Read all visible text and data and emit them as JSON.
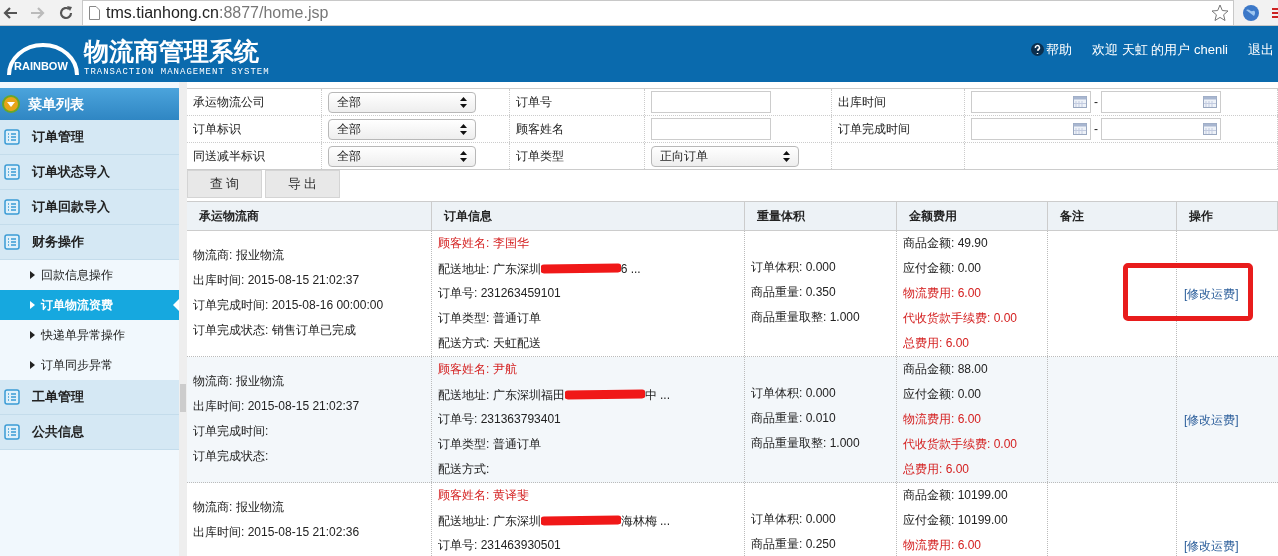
{
  "browser": {
    "url_host": "tms.tianhong.cn",
    "url_path": ":8877/home.jsp"
  },
  "header": {
    "logo_text": "RAINBOW",
    "title": "物流商管理系统",
    "subtitle": "TRANSACTION MANAGEMENT SYSTEM",
    "help": "帮助",
    "welcome": "欢迎 天虹 的用户 chenli",
    "logout": "退出"
  },
  "sidebar": {
    "title": "菜单列表",
    "items": [
      {
        "label": "订单管理",
        "kind": "group",
        "selected": false
      },
      {
        "label": "订单状态导入",
        "kind": "group",
        "selected": false
      },
      {
        "label": "订单回款导入",
        "kind": "group",
        "selected": false
      },
      {
        "label": "财务操作",
        "kind": "group",
        "selected": false
      },
      {
        "label": "回款信息操作",
        "kind": "sub",
        "selected": false
      },
      {
        "label": "订单物流资费",
        "kind": "sub",
        "selected": true
      },
      {
        "label": "快递单异常操作",
        "kind": "sub",
        "selected": false
      },
      {
        "label": "订单同步异常",
        "kind": "sub",
        "selected": false
      },
      {
        "label": "工单管理",
        "kind": "group",
        "selected": false
      },
      {
        "label": "公共信息",
        "kind": "group",
        "selected": false
      }
    ]
  },
  "filters": [
    [
      {
        "kind": "label",
        "text": "承运物流公司"
      },
      {
        "kind": "select",
        "value": "全部"
      },
      {
        "kind": "label",
        "text": "订单号"
      },
      {
        "kind": "input"
      },
      {
        "kind": "label",
        "text": "出库时间"
      },
      {
        "kind": "daterange",
        "separator": "-"
      }
    ],
    [
      {
        "kind": "label",
        "text": "订单标识"
      },
      {
        "kind": "select",
        "value": "全部"
      },
      {
        "kind": "label",
        "text": "顾客姓名"
      },
      {
        "kind": "input"
      },
      {
        "kind": "label",
        "text": "订单完成时间"
      },
      {
        "kind": "daterange",
        "separator": "-"
      }
    ],
    [
      {
        "kind": "label",
        "text": "同送减半标识"
      },
      {
        "kind": "select",
        "value": "全部"
      },
      {
        "kind": "label",
        "text": "订单类型"
      },
      {
        "kind": "select",
        "value": "正向订单"
      },
      {
        "kind": "empty"
      },
      {
        "kind": "empty"
      }
    ]
  ],
  "buttons": [
    "查 询",
    "导 出"
  ],
  "table": {
    "columns": [
      "承运物流商",
      "订单信息",
      "重量体积",
      "金额费用",
      "备注",
      "操作"
    ],
    "rows": [
      {
        "shaded": false,
        "carrier": [
          "物流商: 报业物流",
          "出库时间: 2015-08-15 21:02:37",
          "订单完成时间: 2015-08-16 00:00:00",
          "订单完成状态: 销售订单已完成"
        ],
        "order": {
          "customer": "顾客姓名: 李国华",
          "address_start": "配送地址: 广东深圳",
          "address_end": "6 ...",
          "lines": [
            "订单号: 231263459101",
            "订单类型: 普通订单",
            "配送方式: 天虹配送"
          ]
        },
        "weight": [
          "订单体积: 0.000",
          "商品重量: 0.350",
          "商品重量取整: 1.000"
        ],
        "amount": [
          {
            "text": "商品金额: 49.90",
            "kind": "normal"
          },
          {
            "text": "应付金额: 0.00",
            "kind": "normal"
          },
          {
            "text": "物流费用: 6.00",
            "kind": "alert"
          },
          {
            "text": "代收货款手续费: 0.00",
            "kind": "alert"
          },
          {
            "text": "总费用: 6.00",
            "kind": "alert"
          }
        ],
        "action": {
          "label": "[修改运费]",
          "highlighted": true
        }
      },
      {
        "shaded": true,
        "carrier": [
          "物流商: 报业物流",
          "出库时间: 2015-08-15 21:02:37",
          "订单完成时间:",
          "订单完成状态:"
        ],
        "order": {
          "customer": "顾客姓名: 尹航",
          "address_start": "配送地址: 广东深圳福田",
          "address_end": "中 ...",
          "lines": [
            "订单号: 231363793401",
            "订单类型: 普通订单",
            "配送方式:"
          ]
        },
        "weight": [
          "订单体积: 0.000",
          "商品重量: 0.010",
          "商品重量取整: 1.000"
        ],
        "amount": [
          {
            "text": "商品金额: 88.00",
            "kind": "normal"
          },
          {
            "text": "应付金额: 0.00",
            "kind": "normal"
          },
          {
            "text": "物流费用: 6.00",
            "kind": "alert"
          },
          {
            "text": "代收货款手续费: 0.00",
            "kind": "alert"
          },
          {
            "text": "总费用: 6.00",
            "kind": "alert"
          }
        ],
        "action": {
          "label": "[修改运费]",
          "highlighted": false
        }
      },
      {
        "shaded": false,
        "carrier": [
          "物流商: 报业物流",
          "出库时间: 2015-08-15 21:02:36"
        ],
        "order": {
          "customer": "顾客姓名: 黄译斐",
          "address_start": "配送地址: 广东深圳",
          "address_end": "海林梅 ...",
          "lines": [
            "订单号: 231463930501"
          ]
        },
        "weight": [
          "订单体积: 0.000",
          "商品重量: 0.250"
        ],
        "amount": [
          {
            "text": "商品金额: 10199.00",
            "kind": "normal"
          },
          {
            "text": "应付金额: 10199.00",
            "kind": "normal"
          },
          {
            "text": "物流费用: 6.00",
            "kind": "alert"
          }
        ],
        "action": {
          "label": "[修改运费]",
          "highlighted": false
        }
      }
    ]
  }
}
